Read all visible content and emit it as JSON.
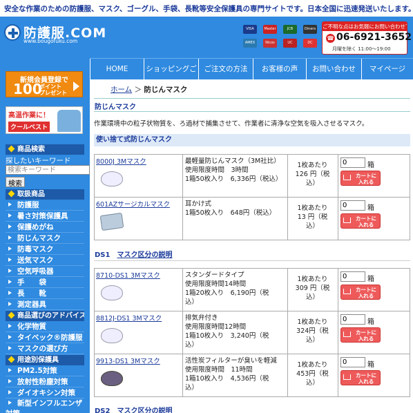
{
  "top_tagline": "安全な作業のための防護服、マスク、ゴーグル、手袋、長靴等安全保護具の専門サイトです。日本全国に迅速発送いたします。",
  "header": {
    "logo_text": "防護服.COM",
    "logo_url": "www.bougofuku.com",
    "payment_cards": [
      "VISA",
      "Master",
      "JCB",
      "Diners",
      "AMEX",
      "Nicos",
      "UC",
      "DC"
    ],
    "contact_note": "ご不明な点はお気軽にお問い合わせ下さい",
    "phone": "06-6921-3652",
    "hours": "月曜を除く 11:00～19:00"
  },
  "nav": {
    "items": [
      "HOME",
      "ショッピングご",
      "ご注文の方法",
      "お客様の声",
      "お問い合わせ",
      "マイページ"
    ]
  },
  "sidebar": {
    "banner_signup": {
      "line1": "新規会員登録で",
      "big": "100",
      "pt1": "ポイント",
      "pt2": "プレゼント"
    },
    "banner_summer": {
      "line1": "高温作業に！",
      "line2": "クールベスト"
    },
    "search_title": "商品検索",
    "search_label": "探したいキーワード",
    "search_placeholder": "検索キーワード",
    "search_button": "検索",
    "products_title": "取扱商品",
    "products": [
      "防護服",
      "暑さ対策保護具",
      "保護めがね",
      "防じんマスク",
      "防毒マスク",
      "送気マスク",
      "空気呼吸器",
      "手　　袋",
      "長　　靴",
      "測定器具"
    ],
    "advice_title": "商品選びのアドバイス",
    "advice": [
      "化学物質",
      "タイベック®防護服",
      "マスクの選び方"
    ],
    "usage_title": "用途別保護具",
    "usage": [
      "PM2.5対策",
      "放射性粉塵対策",
      "ダイオキシン対策",
      "新型インフルエンザ対策"
    ]
  },
  "main": {
    "breadcrumb_home": "ホーム",
    "breadcrumb_sep": "＞",
    "breadcrumb_current": "防じんマスク",
    "heading": "防じんマスク",
    "description": "作業環境中の粒子状物質を、ろ過材で捕集させて、作業者に清浄な空気を吸入させるマスク。",
    "disposable_heading": "使い捨て式防じんマスク",
    "ds1_label": "DS1",
    "ds2_label": "DS2",
    "class_link": "マスク区分の説明",
    "qty_unit": "箱",
    "cart_label": "カートに\n入れる",
    "group1": [
      {
        "name": "8000J 3Mマスク",
        "desc": "最軽量防じんマスク（3M社比）\n使用限度時間　3時間\n1箱50枚入り　6,336円（税込）",
        "price": "1枚あたり\n126 円（税\n込）",
        "qty": "0"
      },
      {
        "name": "601AZサージカルマスク",
        "desc": "耳かけ式\n1箱50枚入り　648円（税込）",
        "price": "1枚あたり\n13 円（税\n込）",
        "qty": "0"
      }
    ],
    "group2": [
      {
        "name": "8710-DS1 3Mマスク",
        "desc": "スタンダードタイプ\n使用限度時間14時間\n1箱20枚入り　6,190円（税\n込）",
        "price": "1枚あたり\n309 円（税\n込）",
        "qty": "0"
      },
      {
        "name": "8812J-DS1 3Mマスク",
        "desc": "排気弁付き\n使用限度時間12時間\n1箱10枚入り　3,240円（税\n込）",
        "price": "1枚あたり\n324円（税\n込）",
        "qty": "0"
      },
      {
        "name": "9913-DS1 3Mマスク",
        "desc": "活性炭フィルターが臭いを軽減\n使用限度時間　11時間\n1箱10枚入り　4,536円（税\n込）",
        "price": "1枚あたり\n453円（税\n込）",
        "qty": "0"
      }
    ]
  }
}
